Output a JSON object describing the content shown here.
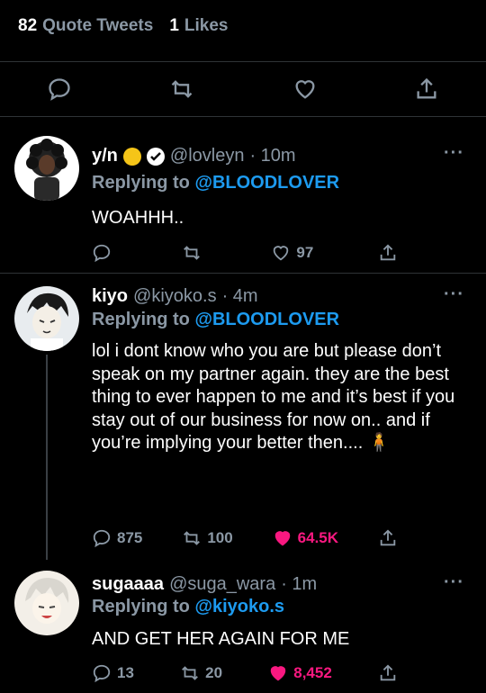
{
  "stats": {
    "quote_count": "82",
    "quote_label": "Quote Tweets",
    "like_count": "1",
    "like_label": "Likes"
  },
  "action_bar": [
    "reply-icon",
    "retweet-icon",
    "heart-icon",
    "share-icon"
  ],
  "tweets": [
    {
      "name": "y/n",
      "handle": "@lovleyn",
      "time": "· 10m",
      "replying_prefix": "Replying to",
      "replying_to": "@BLOODLOVER",
      "text": "WOAHHH..",
      "replies": "",
      "retweets": "",
      "likes": "97",
      "liked": false
    },
    {
      "name": "kiyo",
      "handle": "@kiyoko.s",
      "time": "· 4m",
      "replying_prefix": "Replying to",
      "replying_to": "@BLOODLOVER",
      "text": "lol i dont know who you are but please don’t speak on my partner again. they are the best thing to ever happen to me and it’s best if you stay out of our business for now on.. and if you’re implying your better then.... 🧍",
      "replies": "875",
      "retweets": "100",
      "likes": "64.5K",
      "liked": true
    },
    {
      "name": "sugaaaa",
      "handle": "@suga_wara",
      "time": "· 1m",
      "replying_prefix": "Replying to",
      "replying_to": "@kiyoko.s",
      "text": "AND GET HER AGAIN FOR ME",
      "replies": "13",
      "retweets": "20",
      "likes": "8,452",
      "liked": true
    }
  ],
  "colors": {
    "background": "#000000",
    "muted": "#8b98a5",
    "link": "#1d9bf0",
    "like": "#f91880",
    "divider": "#2f3336"
  }
}
